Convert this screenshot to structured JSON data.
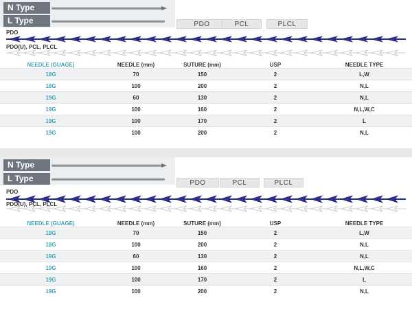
{
  "panels": [
    {
      "types": [
        "N Type",
        "L Type"
      ],
      "materials": [
        "PDO",
        "PCL",
        "PLCL"
      ],
      "bands": [
        "PDO",
        "PDO(U), PCL, PLCL"
      ],
      "table": {
        "headers": [
          "NEEDLE (GUAGE)",
          "NEEDLE (mm)",
          "SUTURE (mm)",
          "USP",
          "NEEDLE TYPE"
        ],
        "rows": [
          [
            "18G",
            "70",
            "150",
            "2",
            "L,W"
          ],
          [
            "18G",
            "100",
            "200",
            "2",
            "N,L"
          ],
          [
            "19G",
            "60",
            "130",
            "2",
            "N,L"
          ],
          [
            "19G",
            "100",
            "160",
            "2",
            "N,L,W,C"
          ],
          [
            "19G",
            "100",
            "170",
            "2",
            "L"
          ],
          [
            "19G",
            "100",
            "200",
            "2",
            "N,L"
          ]
        ]
      }
    },
    {
      "types": [
        "N Type",
        "L Type"
      ],
      "materials": [
        "PDO",
        "PCL",
        "PLCL"
      ],
      "bands": [
        "PDO",
        "PDO(U), PCL, PLCL"
      ],
      "table": {
        "headers": [
          "NEEDLE (GUAGE)",
          "NEEDLE (mm)",
          "SUTURE (mm)",
          "USP",
          "NEEDLE TYPE"
        ],
        "rows": [
          [
            "18G",
            "70",
            "150",
            "2",
            "L,W"
          ],
          [
            "18G",
            "100",
            "200",
            "2",
            "N,L"
          ],
          [
            "19G",
            "60",
            "130",
            "2",
            "N,L"
          ],
          [
            "19G",
            "100",
            "160",
            "2",
            "N,L,W,C"
          ],
          [
            "19G",
            "100",
            "170",
            "2",
            "L"
          ],
          [
            "19G",
            "100",
            "200",
            "2",
            "N,L"
          ]
        ]
      }
    }
  ]
}
